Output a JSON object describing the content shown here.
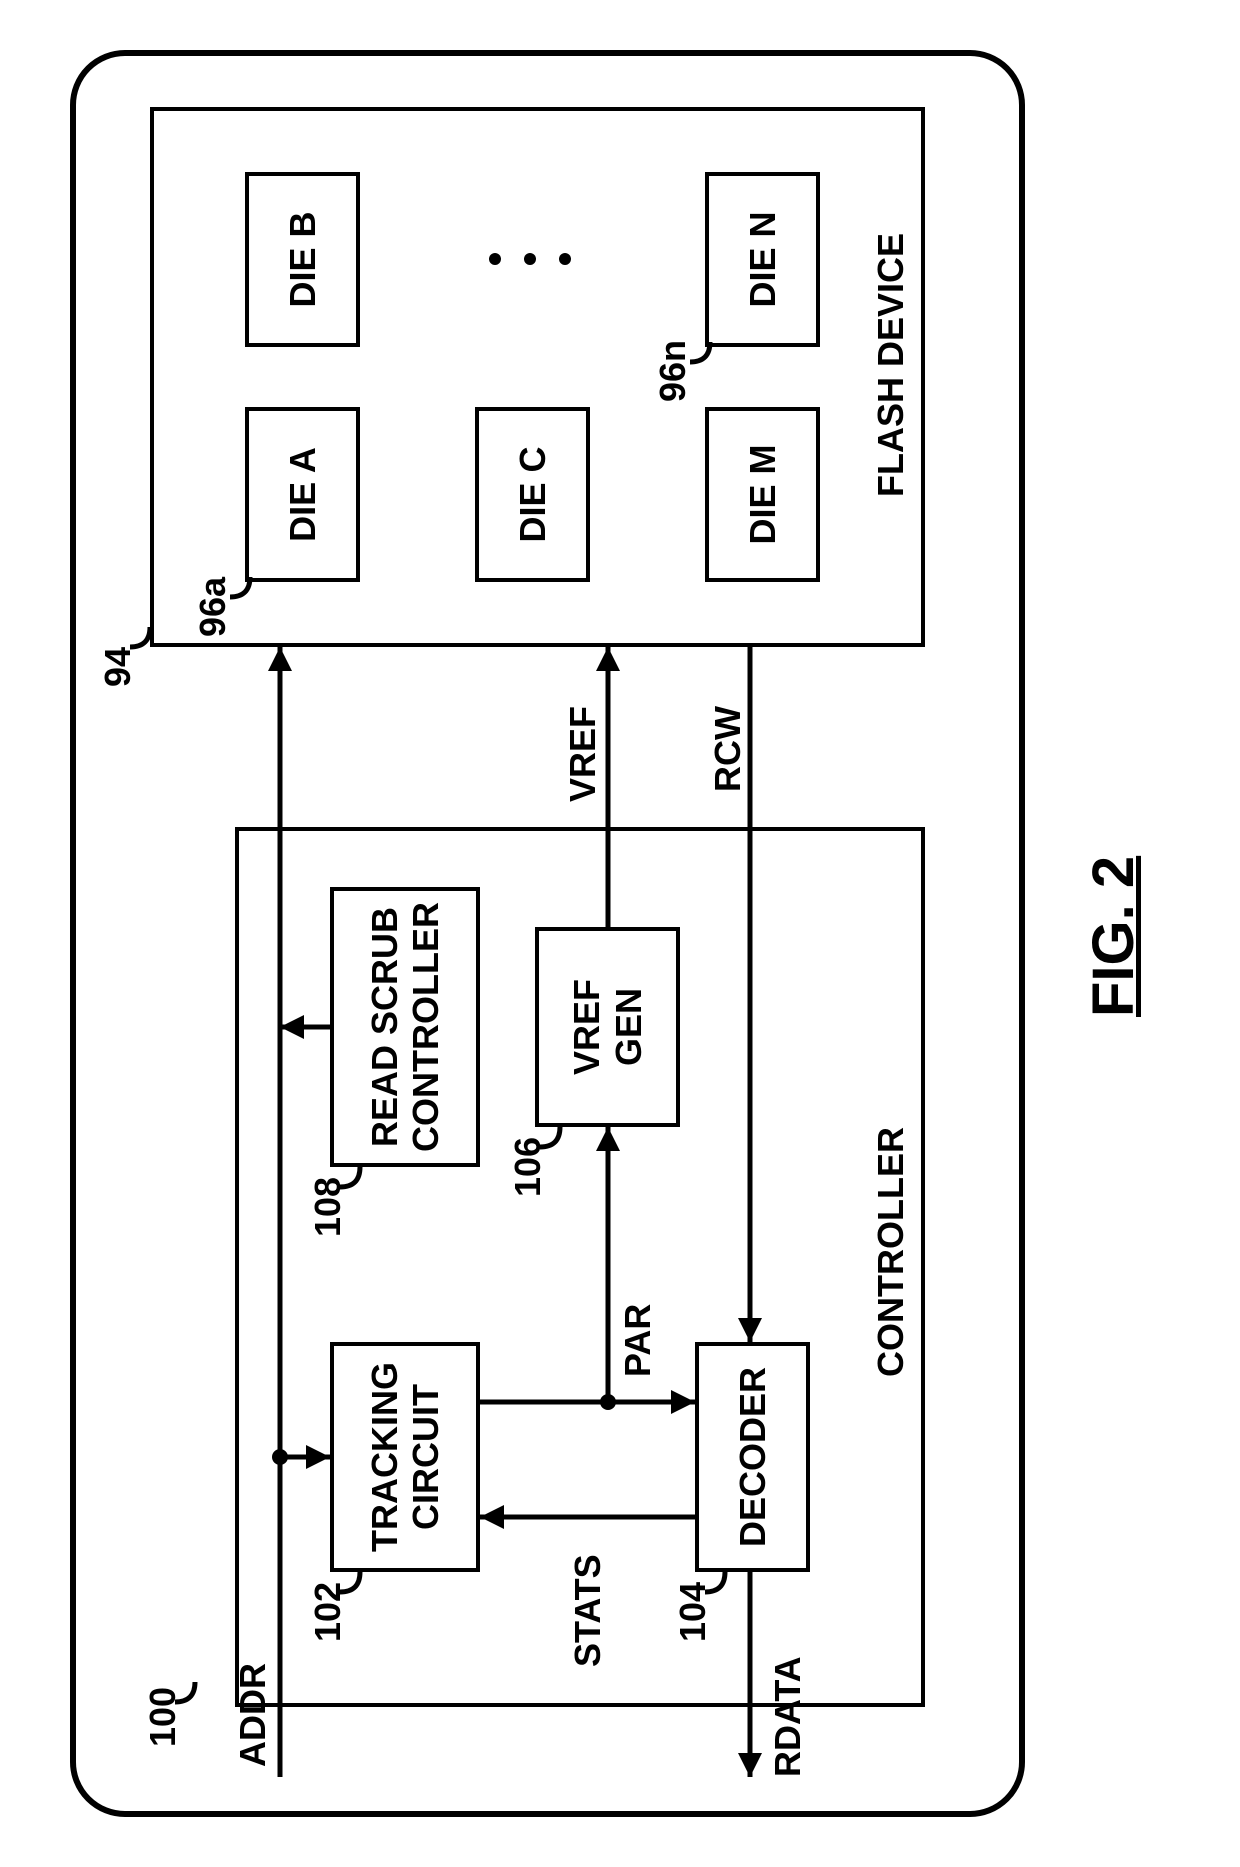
{
  "figure_label": "FIG. 2",
  "controller": {
    "title": "CONTROLLER",
    "ref": "100",
    "tracking": {
      "label": "TRACKING\nCIRCUIT",
      "ref": "102"
    },
    "decoder": {
      "label": "DECODER",
      "ref": "104"
    },
    "vrefgen": {
      "label": "VREF\nGEN",
      "ref": "106"
    },
    "readscrub": {
      "label": "READ SCRUB\nCONTROLLER",
      "ref": "108"
    }
  },
  "flash": {
    "title": "FLASH DEVICE",
    "ref": "94",
    "die_ref_first": "96a",
    "die_ref_last": "96n",
    "dies": [
      "DIE A",
      "DIE B",
      "DIE C",
      "DIE M",
      "DIE N"
    ]
  },
  "signals": {
    "addr": "ADDR",
    "rdata": "RDATA",
    "stats": "STATS",
    "par": "PAR",
    "vref": "VREF",
    "rcw": "RCW"
  }
}
